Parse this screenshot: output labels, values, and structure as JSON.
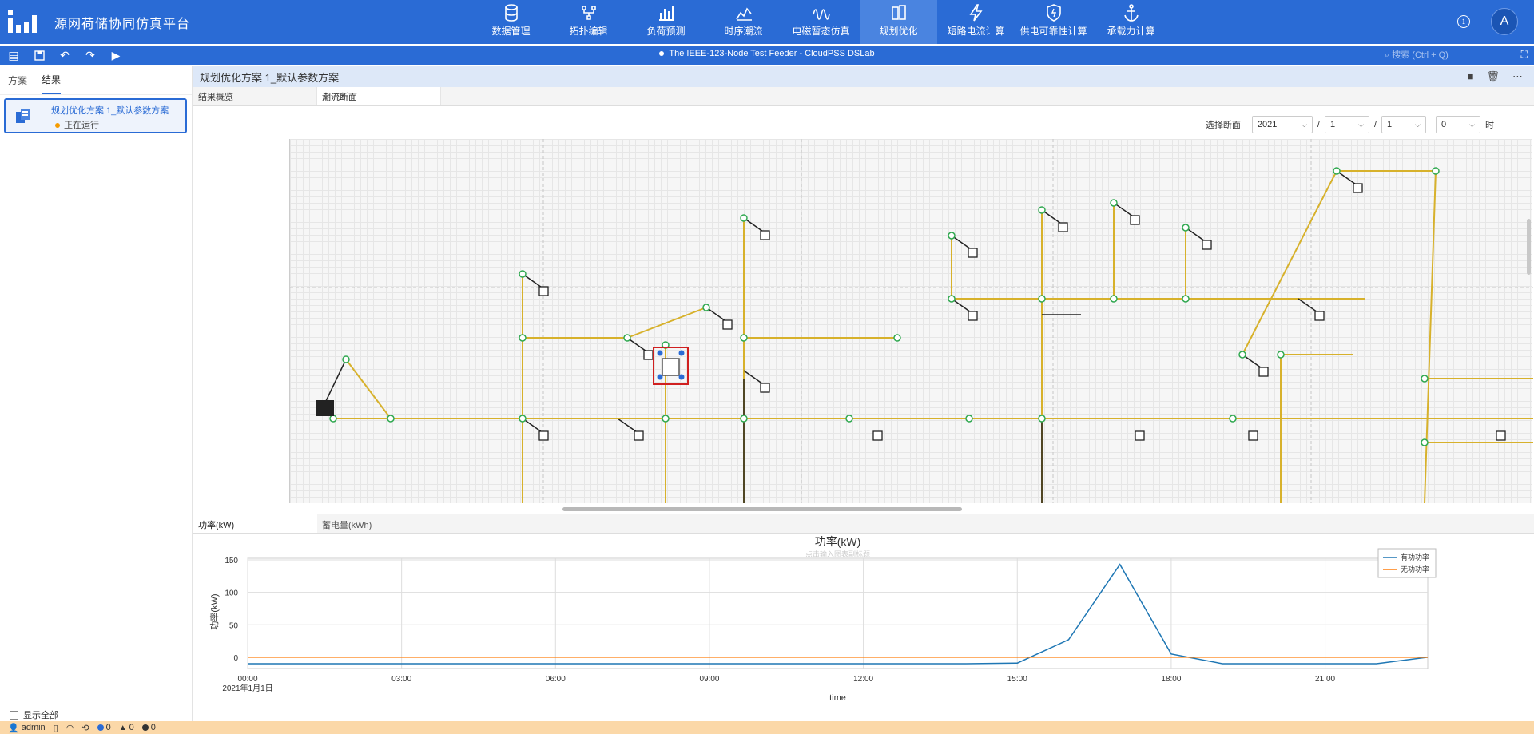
{
  "app": {
    "title": "源网荷储协同仿真平台",
    "user_initial": "A"
  },
  "nav": [
    {
      "label": "数据管理",
      "icon": "database-icon"
    },
    {
      "label": "拓扑编辑",
      "icon": "topology-icon"
    },
    {
      "label": "负荷预测",
      "icon": "bar-chart-icon"
    },
    {
      "label": "时序潮流",
      "icon": "timeseries-icon"
    },
    {
      "label": "电磁暂态仿真",
      "icon": "waveform-icon"
    },
    {
      "label": "规划优化",
      "icon": "plan-icon",
      "active": true
    },
    {
      "label": "短路电流计算",
      "icon": "lightning-icon"
    },
    {
      "label": "供电可靠性计算",
      "icon": "shield-icon"
    },
    {
      "label": "承载力计算",
      "icon": "anchor-icon"
    }
  ],
  "toolbar": {
    "doc_title": "The IEEE-123-Node Test Feeder - CloudPSS DSLab",
    "search_placeholder": "搜索 (Ctrl + Q)"
  },
  "left": {
    "tabs": [
      "方案",
      "结果"
    ],
    "active_tab": "结果",
    "plan": {
      "name": "规划优化方案 1_默认参数方案",
      "status": "正在运行"
    },
    "show_all": "显示全部"
  },
  "main": {
    "title": "规划优化方案 1_默认参数方案",
    "tabs": [
      "结果概览",
      "潮流断面"
    ],
    "active_tab": "潮流断面",
    "selector": {
      "label": "选择断面",
      "year": "2021",
      "month": "1",
      "day": "1",
      "hour": "0",
      "hour_unit": "时",
      "sep": "/"
    },
    "bottom_tabs": [
      "功率(kW)",
      "蓄电量(kWh)"
    ]
  },
  "chart_data": {
    "type": "line",
    "title": "功率(kW)",
    "subtitle": "点击输入图表副标题",
    "xlabel": "time",
    "ylabel": "功率(kW)",
    "xlim": [
      0,
      23
    ],
    "ylim": [
      -10,
      150
    ],
    "yticks": [
      0,
      50,
      100,
      150
    ],
    "xticks": [
      "00:00",
      "03:00",
      "06:00",
      "09:00",
      "12:00",
      "15:00",
      "18:00",
      "21:00"
    ],
    "xdate_label": "2021年1月1日",
    "x": [
      0,
      1,
      2,
      3,
      4,
      5,
      6,
      7,
      8,
      9,
      10,
      11,
      12,
      13,
      14,
      15,
      16,
      17,
      18,
      19,
      20,
      21,
      22,
      23
    ],
    "series": [
      {
        "name": "有功功率",
        "color": "#1f77b4",
        "values": [
          -10,
          -10,
          -10,
          -10,
          -10,
          -10,
          -10,
          -10,
          -10,
          -10,
          -10,
          -10,
          -10,
          -10,
          -10,
          -9,
          27,
          143,
          5,
          -10,
          -10,
          -10,
          -10,
          0
        ]
      },
      {
        "name": "无功功率",
        "color": "#ff7f0e",
        "values": [
          0,
          0,
          0,
          0,
          0,
          0,
          0,
          0,
          0,
          0,
          0,
          0,
          0,
          0,
          0,
          0,
          0,
          0,
          0,
          0,
          0,
          0,
          0,
          0
        ]
      }
    ],
    "grid": true,
    "legend": "top-right"
  },
  "status": {
    "user": "admin",
    "info_count": "0",
    "warn_count": "0",
    "error_count": "0"
  }
}
